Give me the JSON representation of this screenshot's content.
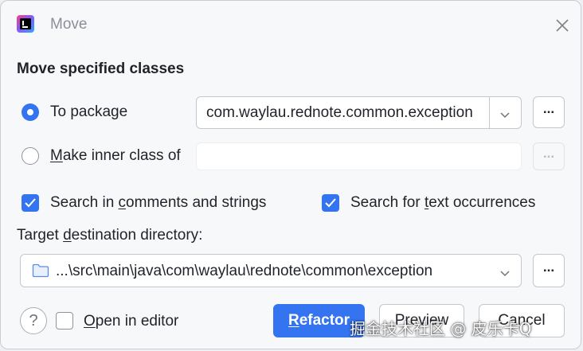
{
  "window": {
    "title": "Move",
    "icon": "intellij-idea-icon",
    "close_icon": "close-icon"
  },
  "section_title": "Move specified classes",
  "to_package": {
    "label": "To package",
    "selected": true,
    "value": "com.waylau.rednote.common.exception",
    "browse_label": "..."
  },
  "inner_class": {
    "label": "Make inner class of",
    "selected": false,
    "value": "",
    "browse_label": "..."
  },
  "options": {
    "search_comments": {
      "label": "Search in comments and strings",
      "checked": true
    },
    "search_text": {
      "label": "Search for text occurrences",
      "checked": true
    }
  },
  "target_dir": {
    "label": "Target destination directory:",
    "value": "...\\src\\main\\java\\com\\waylau\\rednote\\common\\exception",
    "icon": "folder-icon",
    "browse_label": "..."
  },
  "footer": {
    "help_label": "?",
    "open_in_editor": {
      "label": "Open in editor",
      "checked": false
    },
    "refactor_label": "Refactor",
    "preview_label": "Preview",
    "cancel_label": "Cancel"
  },
  "watermark": "掘金技术社区 @ 皮乐卡Q",
  "colors": {
    "accent": "#3574f0",
    "background": "#f7f8fa",
    "border": "#c4c7cd"
  }
}
